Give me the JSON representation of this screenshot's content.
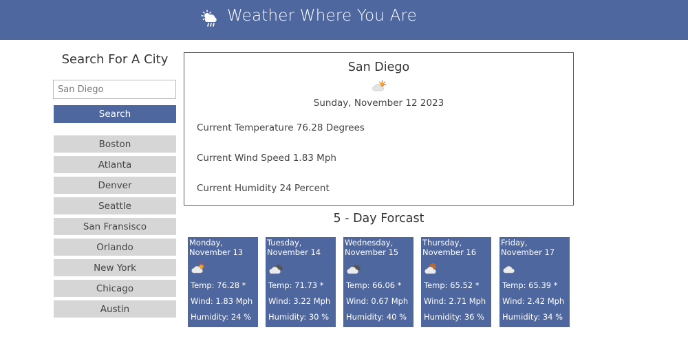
{
  "header": {
    "title": "Weather Where You Are",
    "logo_icon": "cloud-sun-rain-icon"
  },
  "sidebar": {
    "title": "Search For A City",
    "search_placeholder": "San Diego",
    "search_button": "Search",
    "cities": [
      "Boston",
      "Atlanta",
      "Denver",
      "Seattle",
      "San Fransisco",
      "Orlando",
      "New York",
      "Chicago",
      "Austin"
    ]
  },
  "current": {
    "city": "San Diego",
    "icon": "few-clouds-day-icon",
    "date": "Sunday, November 12 2023",
    "temperature": "Current Temperature 76.28 Degrees",
    "wind": "Current Wind Speed 1.83 Mph",
    "humidity": "Current Humidity 24 Percent"
  },
  "forecast": {
    "title": "5 - Day Forcast",
    "days": [
      {
        "date": "Monday, November 13",
        "icon": "few-clouds-day-icon",
        "temp": "Temp: 76.28 *",
        "wind": "Wind: 1.83 Mph",
        "humidity": "Humidity: 24 %"
      },
      {
        "date": "Tuesday, November 14",
        "icon": "broken-clouds-icon",
        "temp": "Temp: 71.73 *",
        "wind": "Wind: 3.22 Mph",
        "humidity": "Humidity: 30 %"
      },
      {
        "date": "Wednesday, November 15",
        "icon": "broken-clouds-icon",
        "temp": "Temp: 66.06 *",
        "wind": "Wind: 0.67 Mph",
        "humidity": "Humidity: 40 %"
      },
      {
        "date": "Thursday, November 16",
        "icon": "scattered-clouds-night-icon",
        "temp": "Temp: 65.52 *",
        "wind": "Wind: 2.71 Mph",
        "humidity": "Humidity: 36 %"
      },
      {
        "date": "Friday, November 17",
        "icon": "cloud-icon",
        "temp": "Temp: 65.39 *",
        "wind": "Wind: 2.42 Mph",
        "humidity": "Humidity: 34 %"
      }
    ]
  },
  "colors": {
    "primary": "#4f679f",
    "city_button": "#d6d6d6",
    "card_text": "#ffffff"
  }
}
